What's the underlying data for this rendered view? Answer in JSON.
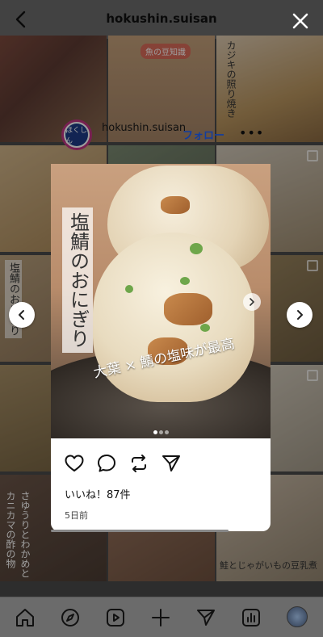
{
  "header": {
    "title": "hokushin.suisan"
  },
  "profile": {
    "name": "hokushin.suisan",
    "follow_label": "フォロー",
    "more": "•••",
    "avatar_text": "ほくしん"
  },
  "post": {
    "title_vertical": "塩鯖のおにぎり",
    "caption": "大葉 × 鯖の塩味が最高",
    "likes": "いいね！87件",
    "date": "5日前",
    "carousel_total": 3,
    "carousel_index": 1,
    "progress_fraction": 0.81
  },
  "grid_tiles": [
    {
      "label": ""
    },
    {
      "label": "魚の豆知識"
    },
    {
      "label": "カジキの照り焼き"
    },
    {
      "label": ""
    },
    {
      "label": ""
    },
    {
      "label": ""
    },
    {
      "label": "塩鯖のおにぎり"
    },
    {
      "label": ""
    },
    {
      "label": ""
    },
    {
      "label": "さゆうりとわかめと カニカマの酢の物"
    },
    {
      "label": ""
    },
    {
      "label": "鮭とじゃがいもの豆乳煮"
    }
  ],
  "icons": {
    "back": "chevron-left-icon",
    "close": "close-icon",
    "like": "heart-icon",
    "comment": "comment-icon",
    "repost": "repost-icon",
    "share": "send-icon"
  },
  "tabbar": [
    "home-icon",
    "explore-icon",
    "reels-icon",
    "create-icon",
    "messages-icon",
    "insights-icon",
    "profile-avatar"
  ],
  "colors": {
    "follow": "#1e63ff",
    "avatar_ring": "#c13584"
  }
}
